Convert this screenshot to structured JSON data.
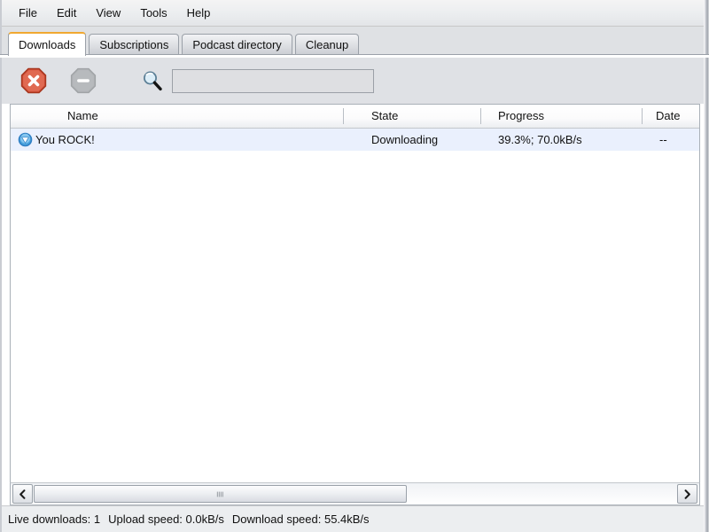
{
  "window": {
    "accent_color": "#f0a830",
    "selection_color": "#eaf0fd"
  },
  "menubar": {
    "items": [
      {
        "label": "File",
        "name": "menu-file"
      },
      {
        "label": "Edit",
        "name": "menu-edit"
      },
      {
        "label": "View",
        "name": "menu-view"
      },
      {
        "label": "Tools",
        "name": "menu-tools"
      },
      {
        "label": "Help",
        "name": "menu-help"
      }
    ]
  },
  "tabs": {
    "active_index": 0,
    "items": [
      {
        "label": "Downloads"
      },
      {
        "label": "Subscriptions"
      },
      {
        "label": "Podcast directory"
      },
      {
        "label": "Cleanup"
      }
    ]
  },
  "toolbar": {
    "cancel_button": {
      "icon": "cancel-octagon-icon",
      "color": "#d9553f",
      "enabled": true
    },
    "remove_button": {
      "icon": "remove-octagon-icon",
      "color": "#b0b3b6",
      "enabled": false
    },
    "search_icon": "search-magnifier-icon",
    "search": {
      "value": "",
      "placeholder": ""
    }
  },
  "list": {
    "columns": [
      {
        "label": "Name",
        "key": "name"
      },
      {
        "label": "State",
        "key": "state"
      },
      {
        "label": "Progress",
        "key": "progress"
      },
      {
        "label": "Date",
        "key": "date"
      }
    ],
    "rows": [
      {
        "icon": "download-arrow-icon",
        "name": "You ROCK!",
        "state": "Downloading",
        "progress": "39.3%; 70.0kB/s",
        "date": "--",
        "selected": true
      }
    ]
  },
  "scrollbar": {
    "left_arrow": "chevron-left-icon",
    "right_arrow": "chevron-right-icon",
    "thumb_grip": "grip-icon"
  },
  "statusbar": {
    "live_downloads": "Live downloads: 1",
    "upload_speed": "Upload speed: 0.0kB/s",
    "download_speed": "Download speed: 55.4kB/s"
  }
}
